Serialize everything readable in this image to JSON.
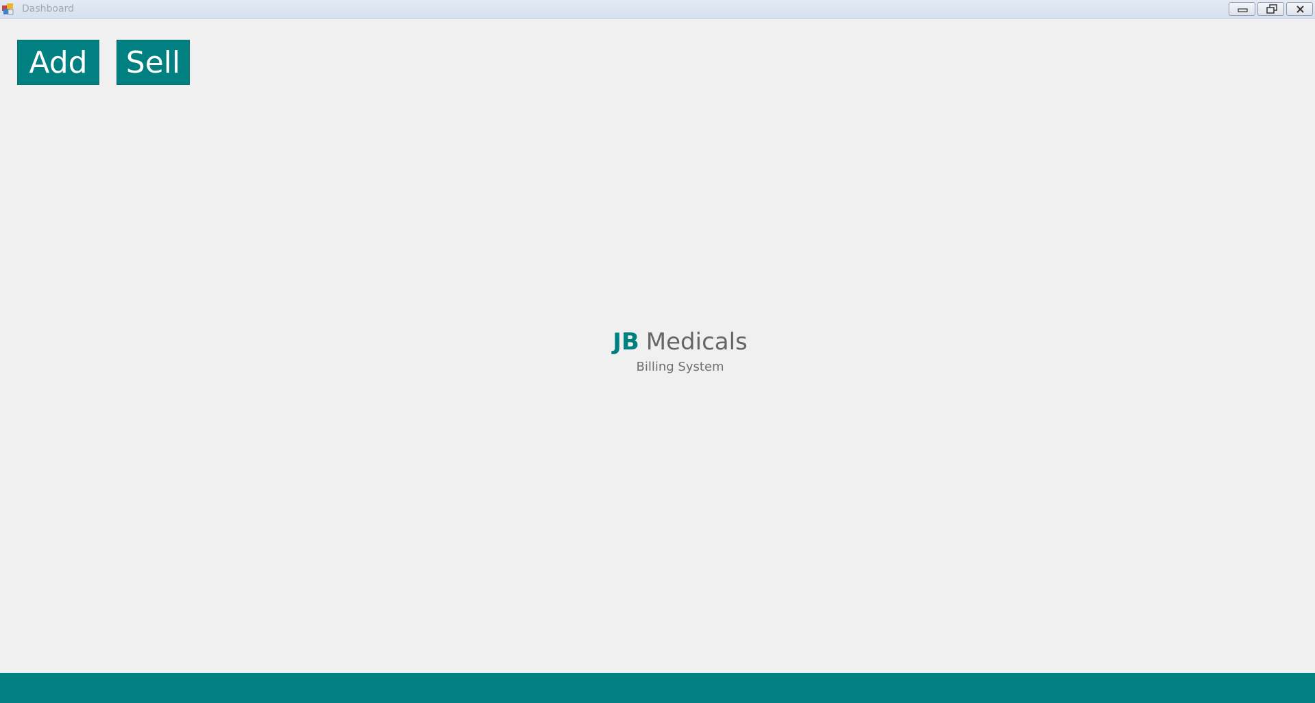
{
  "window": {
    "title": "Dashboard",
    "icon": "app-window-icon",
    "controls": {
      "minimize_icon": "minimize-icon",
      "restore_icon": "restore-icon",
      "close_icon": "close-icon"
    }
  },
  "toolbar": {
    "add_label": "Add",
    "sell_label": "Sell"
  },
  "brand": {
    "abbr": "JB",
    "name": "Medicals",
    "subtitle": "Billing System"
  },
  "colors": {
    "accent": "#008080",
    "background": "#f0f0f0",
    "text_muted": "#666666"
  }
}
